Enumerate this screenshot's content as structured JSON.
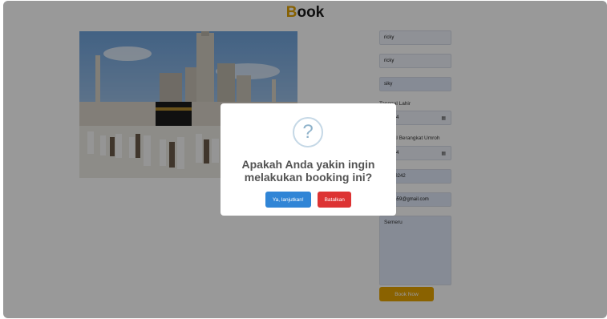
{
  "header": {
    "brand_first_letter": "B",
    "brand_rest": "ook"
  },
  "form": {
    "name_value": "ricky",
    "username_value": "ricky",
    "city_value": "siky",
    "birth_date_label": "Tanggal Lahir",
    "birth_date_value": "1/2024",
    "departure_date_label": "Tanggal Berangkat Umroh",
    "departure_date_value": "1/2024",
    "phone_value": "15098242",
    "email_value": "caplin59@gmail.com",
    "notes_value": "Semeru",
    "submit_label": "Book Now"
  },
  "dialog": {
    "icon": "?",
    "title": "Apakah Anda yakin ingin melakukan booking ini?",
    "confirm_label": "Ya, lanjutkan!",
    "cancel_label": "Batalkan"
  },
  "colors": {
    "brand_accent": "#e0a100",
    "confirm": "#3085d6",
    "cancel": "#dd3333",
    "book_now": "#e7a400"
  }
}
